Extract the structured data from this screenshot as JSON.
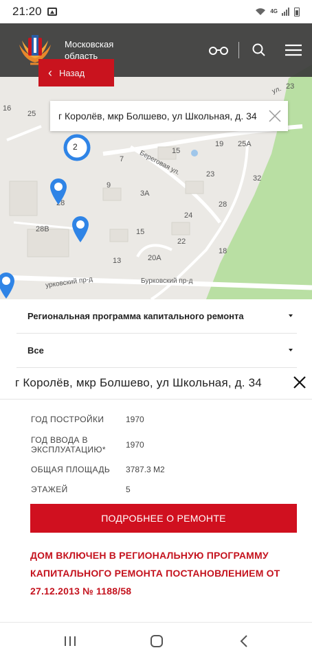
{
  "status_bar": {
    "time": "21:20",
    "network_label": "4G",
    "icons": [
      "gallery-icon",
      "wifi-icon",
      "signal-icon",
      "battery-icon"
    ]
  },
  "header": {
    "brand_line1": "Московская",
    "brand_line2": "область",
    "logo_icon": "coat-of-arms-logo",
    "actions": [
      "low-vision-icon",
      "search-icon",
      "menu-icon"
    ],
    "back_label": "Назад",
    "accent_color": "#d0101f",
    "header_bg": "#3a3a3a"
  },
  "map": {
    "popup_address": "г Королёв, мкр Болшево, ул Школьная, д. 34",
    "cluster_count": "2",
    "labels": {
      "n23a": "23",
      "n25": "25",
      "n16": "16",
      "n15": "15",
      "n19": "19",
      "n25A": "25A",
      "n7": "7",
      "n23b": "23",
      "n32": "32",
      "n3A": "3A",
      "n28a": "28",
      "n9": "9",
      "n28": "28",
      "n24": "24",
      "n28B": "28B",
      "n15b": "15",
      "n22": "22",
      "n18": "18",
      "n20A": "20A",
      "n13": "13",
      "street1": "Береговая ул.",
      "street2": "Бурковский пр-д",
      "street3": "урковский пр-д",
      "street4": "ул."
    },
    "pin_color": "#2f84e6"
  },
  "panel": {
    "program_select": "Региональная программа капитального ремонта",
    "filter_select": "Все",
    "address": "г Королёв, мкр Болшево, ул Школьная, д. 34",
    "info": [
      {
        "key": "ГОД ПОСТРОЙКИ",
        "value": "1970"
      },
      {
        "key": "ГОД ВВОДА В ЭКСПЛУАТАЦИЮ*",
        "value": "1970"
      },
      {
        "key": "ОБЩАЯ ПЛОЩАДЬ",
        "value": "3787.3 М2"
      },
      {
        "key": "ЭТАЖЕЙ",
        "value": "5"
      }
    ],
    "detail_button": "ПОДРОБНЕЕ О РЕМОНТЕ",
    "notice": "ДОМ ВКЛЮЧЕН В РЕГИОНАЛЬНУЮ ПРОГРАММУ КАПИТАЛЬНОГО РЕМОНТА ПОСТАНОВЛЕНИЕМ ОТ 27.12.2013 № 1188/58"
  },
  "navbar": {
    "buttons": [
      "recents-icon",
      "home-icon",
      "back-icon"
    ]
  }
}
